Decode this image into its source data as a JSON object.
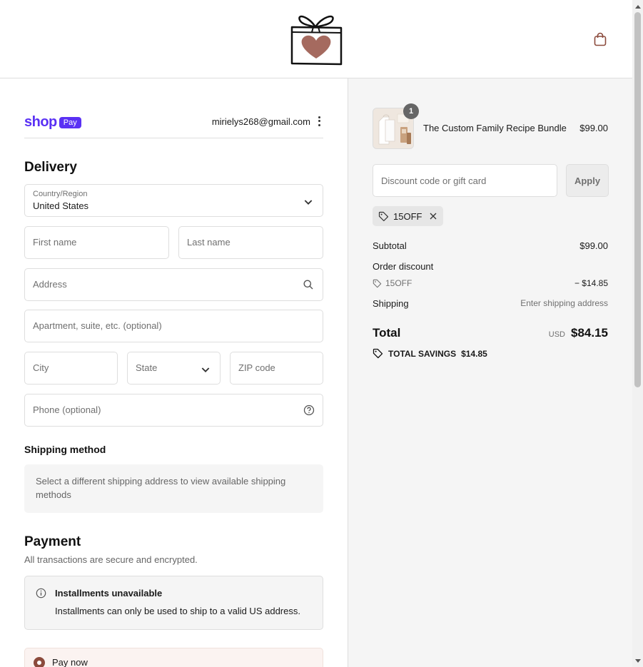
{
  "header": {
    "logo_name": "gift-heart-logo",
    "cart_icon": "shopping-bag-icon"
  },
  "shop_pay": {
    "brand": "shop",
    "badge": "Pay",
    "email": "mirielys268@gmail.com"
  },
  "delivery": {
    "title": "Delivery",
    "country_label": "Country/Region",
    "country_value": "United States",
    "first_name_placeholder": "First name",
    "last_name_placeholder": "Last name",
    "address_placeholder": "Address",
    "apartment_placeholder": "Apartment, suite, etc. (optional)",
    "city_placeholder": "City",
    "state_placeholder": "State",
    "zip_placeholder": "ZIP code",
    "phone_placeholder": "Phone (optional)"
  },
  "shipping_method": {
    "title": "Shipping method",
    "message": "Select a different shipping address to view available shipping methods"
  },
  "payment": {
    "title": "Payment",
    "subtitle": "All transactions are secure and encrypted.",
    "installments_title": "Installments unavailable",
    "installments_text": "Installments can only be used to ship to a valid US address.",
    "pay_now_label": "Pay now"
  },
  "order": {
    "product_name": "The Custom Family Recipe Bundle",
    "product_price": "$99.00",
    "quantity": "1",
    "discount_placeholder": "Discount code or gift card",
    "apply_label": "Apply",
    "applied_code": "15OFF",
    "subtotal_label": "Subtotal",
    "subtotal_value": "$99.00",
    "order_discount_label": "Order discount",
    "discount_code": "15OFF",
    "discount_value": "− $14.85",
    "shipping_label": "Shipping",
    "shipping_value": "Enter shipping address",
    "total_label": "Total",
    "currency": "USD",
    "total_value": "$84.15",
    "savings_label": "TOTAL SAVINGS",
    "savings_value": "$14.85"
  },
  "colors": {
    "accent": "#8b4a3c",
    "shop_pay": "#5a31f4",
    "sidebar_bg": "#f5f5f5"
  }
}
